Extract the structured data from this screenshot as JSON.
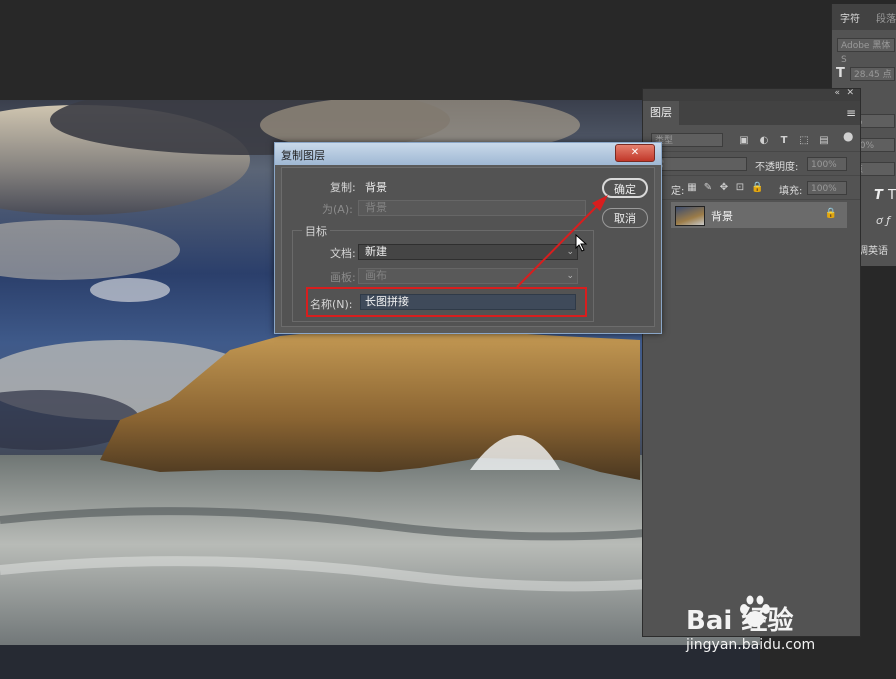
{
  "char_panel": {
    "tabs": [
      "字符",
      "段落"
    ],
    "font": "Adobe 黑体 S",
    "size": "28.45 点",
    "values": [
      "%",
      "00%",
      "点"
    ],
    "type_label": "T",
    "lang": "调英语"
  },
  "layers_panel": {
    "tab": "图层",
    "filter": "类型",
    "blend": "常",
    "opacity_label": "不透明度:",
    "opacity_value": "100%",
    "lock_label": "定:",
    "fill_label": "填充:",
    "fill_value": "100%",
    "layer": {
      "name": "背景"
    }
  },
  "dialog": {
    "title": "复制图层",
    "close": "✕",
    "copy_label": "复制:",
    "copy_value": "背景",
    "as_label": "为(A):",
    "as_value": "背景",
    "target_label": "目标",
    "doc_label": "文档:",
    "doc_value": "新建",
    "artboard_label": "画板:",
    "artboard_value": "画布",
    "name_label": "名称(N):",
    "name_value": "长图拼接",
    "ok": "确定",
    "cancel": "取消"
  },
  "watermark": {
    "main": "Bai  经验",
    "sub": "jingyan.baidu.com"
  },
  "colors": {
    "highlight": "#d81e1e",
    "dialog_bg": "#535353",
    "titlebar": "#b5c9df"
  }
}
